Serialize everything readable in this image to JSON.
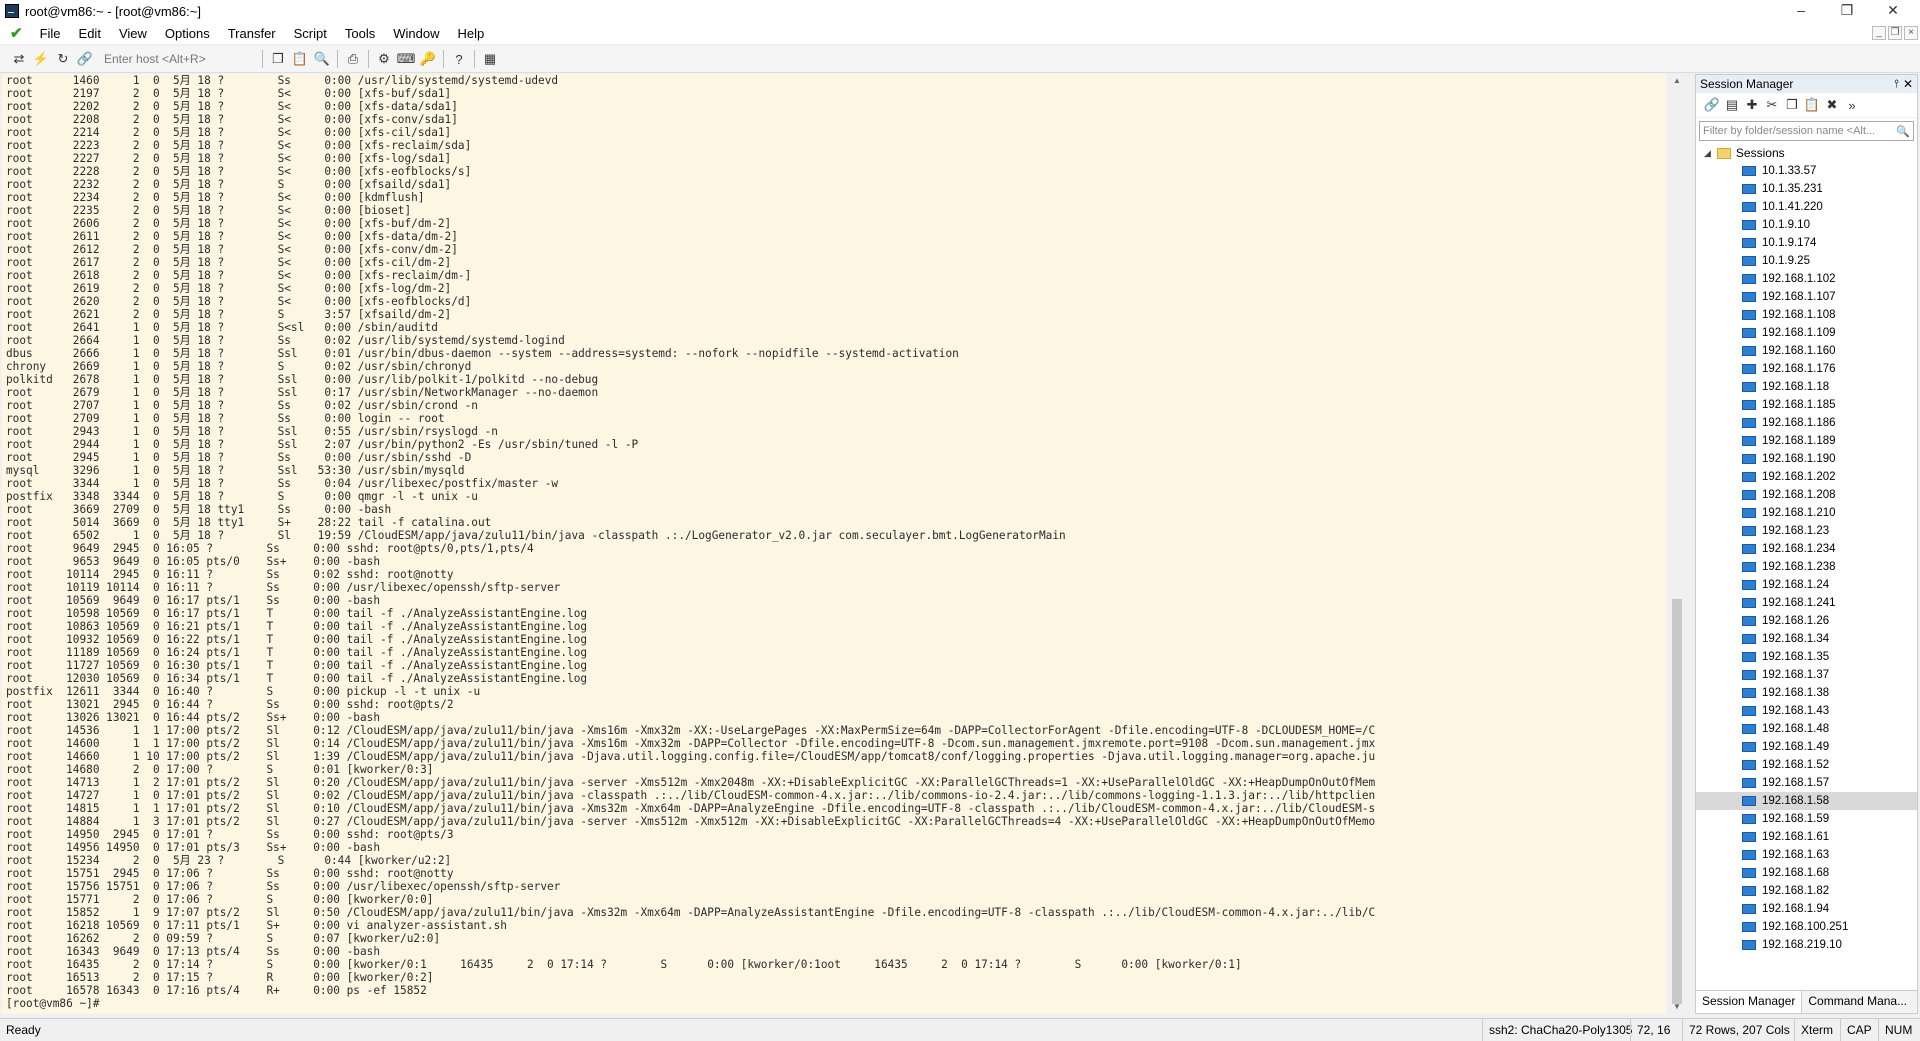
{
  "window": {
    "title": "root@vm86:~ - [root@vm86:~]",
    "minimize": "–",
    "maximize": "❐",
    "close": "✕"
  },
  "menu": [
    "File",
    "Edit",
    "View",
    "Options",
    "Transfer",
    "Script",
    "Tools",
    "Window",
    "Help"
  ],
  "mdi": {
    "minimize": "_",
    "restore": "❐",
    "close": "×"
  },
  "toolbar": {
    "host_placeholder": "Enter host <Alt+R>"
  },
  "terminal": {
    "lines": [
      "root      1460     1  0  5月 18 ?        Ss     0:00 /usr/lib/systemd/systemd-udevd",
      "root      2197     2  0  5月 18 ?        S<     0:00 [xfs-buf/sda1]",
      "root      2202     2  0  5月 18 ?        S<     0:00 [xfs-data/sda1]",
      "root      2208     2  0  5月 18 ?        S<     0:00 [xfs-conv/sda1]",
      "root      2214     2  0  5月 18 ?        S<     0:00 [xfs-cil/sda1]",
      "root      2223     2  0  5月 18 ?        S<     0:00 [xfs-reclaim/sda]",
      "root      2227     2  0  5月 18 ?        S<     0:00 [xfs-log/sda1]",
      "root      2228     2  0  5月 18 ?        S<     0:00 [xfs-eofblocks/s]",
      "root      2232     2  0  5月 18 ?        S      0:00 [xfsaild/sda1]",
      "root      2234     2  0  5月 18 ?        S<     0:00 [kdmflush]",
      "root      2235     2  0  5月 18 ?        S<     0:00 [bioset]",
      "root      2606     2  0  5月 18 ?        S<     0:00 [xfs-buf/dm-2]",
      "root      2611     2  0  5月 18 ?        S<     0:00 [xfs-data/dm-2]",
      "root      2612     2  0  5月 18 ?        S<     0:00 [xfs-conv/dm-2]",
      "root      2617     2  0  5月 18 ?        S<     0:00 [xfs-cil/dm-2]",
      "root      2618     2  0  5月 18 ?        S<     0:00 [xfs-reclaim/dm-]",
      "root      2619     2  0  5月 18 ?        S<     0:00 [xfs-log/dm-2]",
      "root      2620     2  0  5月 18 ?        S<     0:00 [xfs-eofblocks/d]",
      "root      2621     2  0  5月 18 ?        S      3:57 [xfsaild/dm-2]",
      "root      2641     1  0  5月 18 ?        S<sl   0:00 /sbin/auditd",
      "root      2664     1  0  5月 18 ?        Ss     0:02 /usr/lib/systemd/systemd-logind",
      "dbus      2666     1  0  5月 18 ?        Ssl    0:01 /usr/bin/dbus-daemon --system --address=systemd: --nofork --nopidfile --systemd-activation",
      "chrony    2669     1  0  5月 18 ?        S      0:02 /usr/sbin/chronyd",
      "polkitd   2678     1  0  5月 18 ?        Ssl    0:00 /usr/lib/polkit-1/polkitd --no-debug",
      "root      2679     1  0  5月 18 ?        Ssl    0:17 /usr/sbin/NetworkManager --no-daemon",
      "root      2707     1  0  5月 18 ?        Ss     0:02 /usr/sbin/crond -n",
      "root      2709     1  0  5月 18 ?        Ss     0:00 login -- root",
      "root      2943     1  0  5月 18 ?        Ssl    0:55 /usr/sbin/rsyslogd -n",
      "root      2944     1  0  5月 18 ?        Ssl    2:07 /usr/bin/python2 -Es /usr/sbin/tuned -l -P",
      "root      2945     1  0  5月 18 ?        Ss     0:00 /usr/sbin/sshd -D",
      "mysql     3296     1  0  5月 18 ?        Ssl   53:30 /usr/sbin/mysqld",
      "root      3344     1  0  5月 18 ?        Ss     0:04 /usr/libexec/postfix/master -w",
      "postfix   3348  3344  0  5月 18 ?        S      0:00 qmgr -l -t unix -u",
      "root      3669  2709  0  5月 18 tty1     Ss     0:00 -bash",
      "root      5014  3669  0  5月 18 tty1     S+    28:22 tail -f catalina.out",
      "root      6502     1  0  5月 18 ?        Sl    19:59 /CloudESM/app/java/zulu11/bin/java -classpath .:./LogGenerator_v2.0.jar com.seculayer.bmt.LogGeneratorMain",
      "root      9649  2945  0 16:05 ?        Ss     0:00 sshd: root@pts/0,pts/1,pts/4",
      "root      9653  9649  0 16:05 pts/0    Ss+    0:00 -bash",
      "root     10114  2945  0 16:11 ?        Ss     0:02 sshd: root@notty",
      "root     10119 10114  0 16:11 ?        Ss     0:00 /usr/libexec/openssh/sftp-server",
      "root     10569  9649  0 16:17 pts/1    Ss     0:00 -bash",
      "root     10598 10569  0 16:17 pts/1    T      0:00 tail -f ./AnalyzeAssistantEngine.log",
      "root     10863 10569  0 16:21 pts/1    T      0:00 tail -f ./AnalyzeAssistantEngine.log",
      "root     10932 10569  0 16:22 pts/1    T      0:00 tail -f ./AnalyzeAssistantEngine.log",
      "root     11189 10569  0 16:24 pts/1    T      0:00 tail -f ./AnalyzeAssistantEngine.log",
      "root     11727 10569  0 16:30 pts/1    T      0:00 tail -f ./AnalyzeAssistantEngine.log",
      "root     12030 10569  0 16:34 pts/1    T      0:00 tail -f ./AnalyzeAssistantEngine.log",
      "postfix  12611  3344  0 16:40 ?        S      0:00 pickup -l -t unix -u",
      "root     13021  2945  0 16:44 ?        Ss     0:00 sshd: root@pts/2",
      "root     13026 13021  0 16:44 pts/2    Ss+    0:00 -bash",
      "root     14536     1  1 17:00 pts/2    Sl     0:12 /CloudESM/app/java/zulu11/bin/java -Xms16m -Xmx32m -XX:-UseLargePages -XX:MaxPermSize=64m -DAPP=CollectorForAgent -Dfile.encoding=UTF-8 -DCLOUDESM_HOME=/C",
      "root     14600     1  1 17:00 pts/2    Sl     0:14 /CloudESM/app/java/zulu11/bin/java -Xms16m -Xmx32m -DAPP=Collector -Dfile.encoding=UTF-8 -Dcom.sun.management.jmxremote.port=9108 -Dcom.sun.management.jmx",
      "root     14660     1 10 17:00 pts/2    Sl     1:39 /CloudESM/app/java/zulu11/bin/java -Djava.util.logging.config.file=/CloudESM/app/tomcat8/conf/logging.properties -Djava.util.logging.manager=org.apache.ju",
      "root     14680     2  0 17:00 ?        S      0:01 [kworker/0:3]",
      "root     14713     1  2 17:01 pts/2    Sl     0:20 /CloudESM/app/java/zulu11/bin/java -server -Xms512m -Xmx2048m -XX:+DisableExplicitGC -XX:ParallelGCThreads=1 -XX:+UseParallelOldGC -XX:+HeapDumpOnOutOfMem",
      "root     14727     1  0 17:01 pts/2    Sl     0:02 /CloudESM/app/java/zulu11/bin/java -classpath .:../lib/CloudESM-common-4.x.jar:../lib/commons-io-2.4.jar:../lib/commons-logging-1.1.3.jar:../lib/httpclien",
      "root     14815     1  1 17:01 pts/2    Sl     0:10 /CloudESM/app/java/zulu11/bin/java -Xms32m -Xmx64m -DAPP=AnalyzeEngine -Dfile.encoding=UTF-8 -classpath .:../lib/CloudESM-common-4.x.jar:../lib/CloudESM-s",
      "root     14884     1  3 17:01 pts/2    Sl     0:27 /CloudESM/app/java/zulu11/bin/java -server -Xms512m -Xmx512m -XX:+DisableExplicitGC -XX:ParallelGCThreads=4 -XX:+UseParallelOldGC -XX:+HeapDumpOnOutOfMemo",
      "root     14950  2945  0 17:01 ?        Ss     0:00 sshd: root@pts/3",
      "root     14956 14950  0 17:01 pts/3    Ss+    0:00 -bash",
      "root     15234     2  0  5月 23 ?        S      0:44 [kworker/u2:2]",
      "root     15751  2945  0 17:06 ?        Ss     0:00 sshd: root@notty",
      "root     15756 15751  0 17:06 ?        Ss     0:00 /usr/libexec/openssh/sftp-server",
      "root     15771     2  0 17:06 ?        S      0:00 [kworker/0:0]",
      "root     15852     1  9 17:07 pts/2    Sl     0:50 /CloudESM/app/java/zulu11/bin/java -Xms32m -Xmx64m -DAPP=AnalyzeAssistantEngine -Dfile.encoding=UTF-8 -classpath .:../lib/CloudESM-common-4.x.jar:../lib/C",
      "root     16218 10569  0 17:11 pts/1    S+     0:00 vi analyzer-assistant.sh",
      "root     16262     2  0 09:59 ?        S      0:07 [kworker/u2:0]",
      "root     16343  9649  0 17:13 pts/4    Ss     0:00 -bash",
      "root     16435     2  0 17:14 ?        S      0:00 [kworker/0:1]",
      "root     16513     2  0 17:15 ?        R      0:00 [kworker/0:2]",
      "root     16578 16343  0 17:16 pts/4    R+     0:00 ps -ef 15852",
      "[root@vm86 ~]#"
    ],
    "highlight_line_index": 68,
    "highlight_pid": "15852",
    "highlight_ppid": "1"
  },
  "session_manager": {
    "title": "Session Manager",
    "pin": "⫯",
    "close": "✕",
    "filter_placeholder": "Filter by folder/session name <Alt...",
    "root_folder": "Sessions",
    "sessions": [
      "10.1.33.57",
      "10.1.35.231",
      "10.1.41.220",
      "10.1.9.10",
      "10.1.9.174",
      "10.1.9.25",
      "192.168.1.102",
      "192.168.1.107",
      "192.168.1.108",
      "192.168.1.109",
      "192.168.1.160",
      "192.168.1.176",
      "192.168.1.18",
      "192.168.1.185",
      "192.168.1.186",
      "192.168.1.189",
      "192.168.1.190",
      "192.168.1.202",
      "192.168.1.208",
      "192.168.1.210",
      "192.168.1.23",
      "192.168.1.234",
      "192.168.1.238",
      "192.168.1.24",
      "192.168.1.241",
      "192.168.1.26",
      "192.168.1.34",
      "192.168.1.35",
      "192.168.1.37",
      "192.168.1.38",
      "192.168.1.43",
      "192.168.1.48",
      "192.168.1.49",
      "192.168.1.52",
      "192.168.1.57",
      "192.168.1.58",
      "192.168.1.59",
      "192.168.1.61",
      "192.168.1.63",
      "192.168.1.68",
      "192.168.1.82",
      "192.168.1.94",
      "192.168.100.251",
      "192.168.219.10"
    ],
    "selected_index": 35,
    "tabs": [
      "Session Manager",
      "Command Mana..."
    ]
  },
  "status": {
    "ready": "Ready",
    "cipher": "ssh2: ChaCha20-Poly1305",
    "cursor": "72,  16",
    "size": "72 Rows, 207 Cols",
    "term": "Xterm",
    "cap": "CAP",
    "num": "NUM"
  },
  "colors": {
    "terminal_bg": "#fdf6e3",
    "highlight": "#ffff33",
    "selected_row": "#d9d9d9",
    "check": "#2a9d2a"
  }
}
